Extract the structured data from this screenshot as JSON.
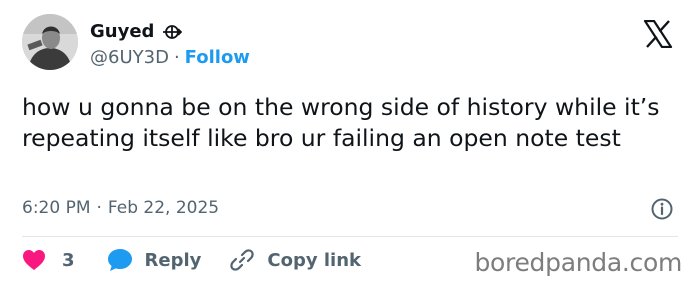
{
  "header": {
    "display_name": "Guyed",
    "name_icon": "globe-crossed-icon",
    "handle": "@6UY3D",
    "separator": "·",
    "follow_label": "Follow",
    "platform_logo": "x-logo-icon"
  },
  "tweet": {
    "text": "how u gonna be on the wrong side of history while it’s repeating itself like bro ur failing an open note test",
    "time": "6:20 PM",
    "separator": "·",
    "date": "Feb 22, 2025"
  },
  "actions": {
    "like_count": "3",
    "reply_label": "Reply",
    "copy_link_label": "Copy link"
  },
  "watermark": "boredpanda.com",
  "colors": {
    "accent": "#1d9bf0",
    "like": "#f91880",
    "text": "#0f1419",
    "muted": "#536471"
  }
}
